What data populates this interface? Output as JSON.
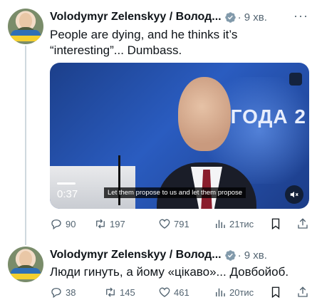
{
  "tweets": [
    {
      "author_name": "Volodymyr Zelenskyy / Волод...",
      "time": "· 9 хв.",
      "text_lines": [
        "People are dying, and he thinks it’s",
        "“interesting”... Dumbass."
      ],
      "media": {
        "duration": "0:37",
        "subtitle": "Let them propose to us and let them propose",
        "background_text": "ГОДА 2"
      },
      "actions": {
        "replies": "90",
        "retweets": "197",
        "likes": "791",
        "views": "21тис"
      }
    },
    {
      "author_name": "Volodymyr Zelenskyy / Волод...",
      "time": "· 9 хв.",
      "text_lines": [
        "Люди гинуть, а йому «цікаво»... Довбойоб."
      ],
      "actions": {
        "replies": "38",
        "retweets": "145",
        "likes": "461",
        "views": "20тис"
      }
    }
  ],
  "icons": {
    "verified": "verified-badge-icon",
    "more": "more-dots-icon",
    "reply": "reply-icon",
    "retweet": "retweet-icon",
    "like": "heart-icon",
    "views": "views-chart-icon",
    "bookmark": "bookmark-icon",
    "share": "share-icon",
    "mute": "speaker-muted-icon"
  },
  "colors": {
    "verified_blue": "#1d9bf0",
    "muted_text": "#536471",
    "thread_line": "#cfd9de"
  }
}
